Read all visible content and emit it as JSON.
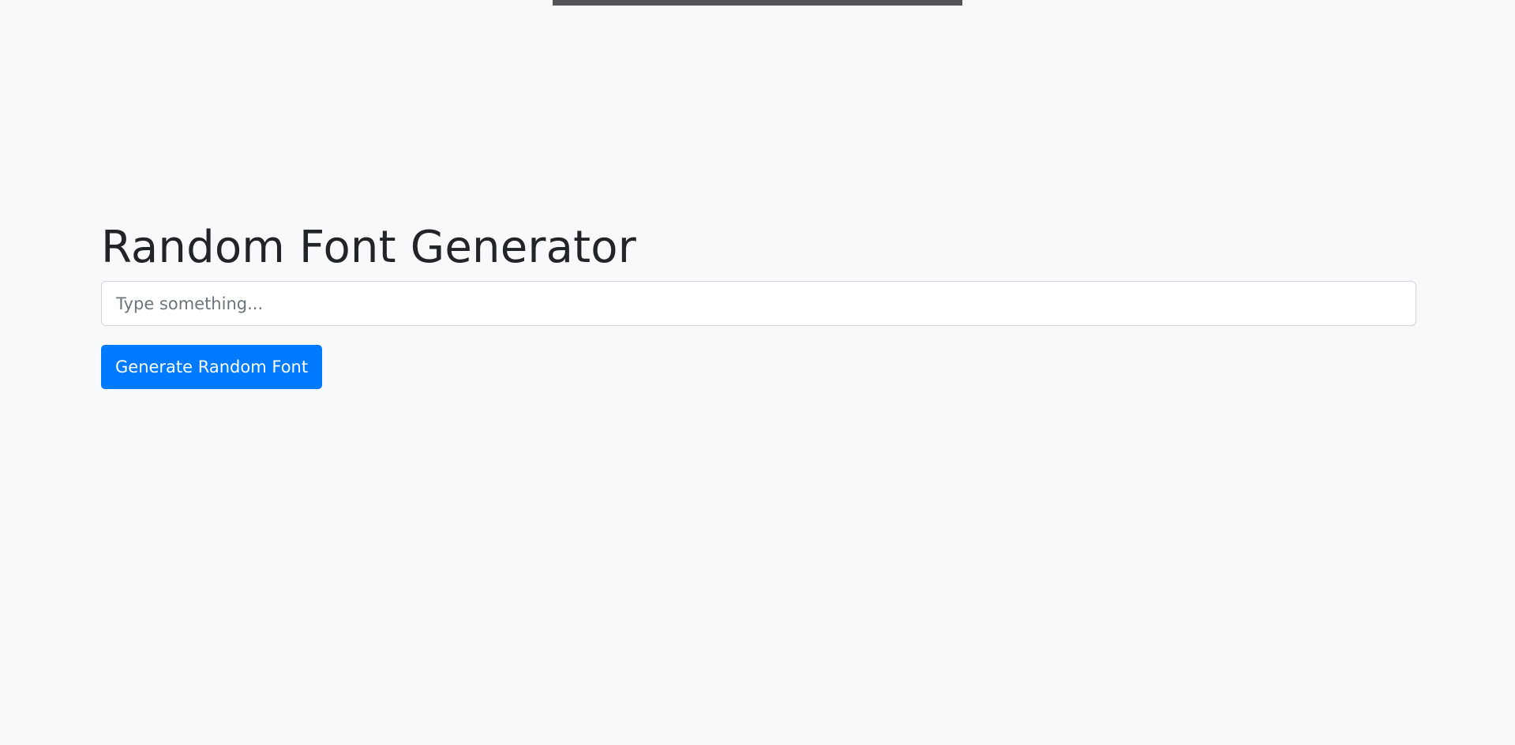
{
  "header": {
    "title": "Random Font Generator"
  },
  "input": {
    "placeholder": "Type something...",
    "value": ""
  },
  "actions": {
    "generate_label": "Generate Random Font"
  },
  "colors": {
    "background": "#f8f9fa",
    "primary": "#007bff",
    "top_bar": "#545558",
    "text": "#212529"
  }
}
